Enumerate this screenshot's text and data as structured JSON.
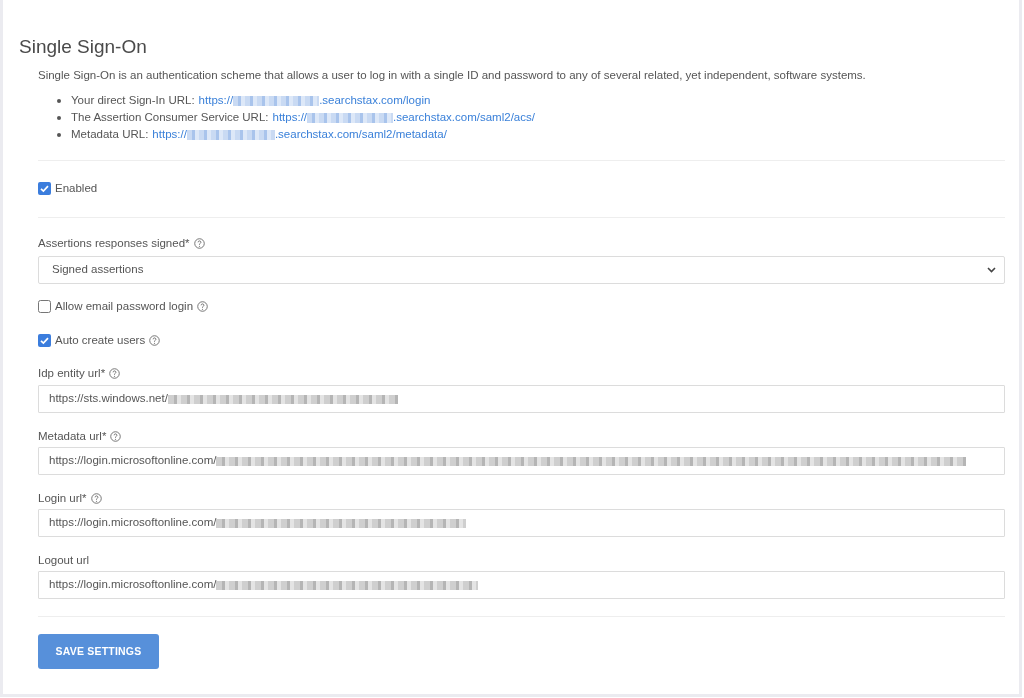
{
  "title": "Single Sign-On",
  "description": "Single Sign-On is an authentication scheme that allows a user to log in with a single ID and password to any of several related, yet independent, software systems.",
  "urls": [
    {
      "label": "Your direct Sign-In URL:",
      "url_start": "https://",
      "url_end": ".searchstax.com/login",
      "redacted": true
    },
    {
      "label": "The Assertion Consumer Service URL:",
      "url_start": "https://",
      "url_end": ".searchstax.com/saml2/acs/",
      "redacted": true
    },
    {
      "label": "Metadata URL:",
      "url_start": "https://",
      "url_end": ".searchstax.com/saml2/metadata/",
      "redacted": true
    }
  ],
  "enabled": {
    "label": "Enabled",
    "checked": true
  },
  "fields": [
    {
      "kind": "select",
      "label": "Assertions responses signed*",
      "help": true,
      "value": "Signed assertions"
    },
    {
      "kind": "checkbox",
      "label": "Allow email password login",
      "help": true,
      "checked": false
    },
    {
      "kind": "checkbox",
      "label": "Auto create users",
      "help": true,
      "checked": true
    },
    {
      "kind": "text",
      "label": "Idp entity url*",
      "help": true,
      "value": "https://sts.windows.net/",
      "redacted": true
    },
    {
      "kind": "text",
      "label": "Metadata url*",
      "help": true,
      "value": "https://login.microsoftonline.com/",
      "redacted": true
    },
    {
      "kind": "text",
      "label": "Login url*",
      "help": true,
      "value": "https://login.microsoftonline.com/",
      "redacted": true
    },
    {
      "kind": "text",
      "label": "Logout url",
      "help": false,
      "value": "https://login.microsoftonline.com/",
      "redacted": true
    }
  ],
  "save_button": {
    "label": "SAVE SETTINGS"
  }
}
